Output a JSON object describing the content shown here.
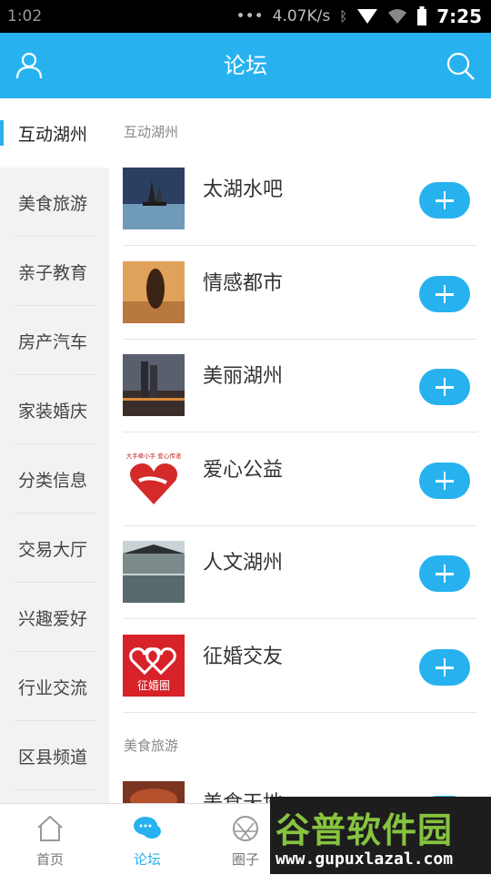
{
  "status_bar": {
    "left_time": "1:02",
    "speed": "4.07K/s",
    "clock": "7:25"
  },
  "header": {
    "title": "论坛",
    "user_icon": "user-icon",
    "search_icon": "search-icon"
  },
  "sidebar": {
    "items": [
      {
        "label": "互动湖州",
        "active": true
      },
      {
        "label": "美食旅游"
      },
      {
        "label": "亲子教育"
      },
      {
        "label": "房产汽车"
      },
      {
        "label": "家装婚庆"
      },
      {
        "label": "分类信息"
      },
      {
        "label": "交易大厅"
      },
      {
        "label": "兴趣爱好"
      },
      {
        "label": "行业交流"
      },
      {
        "label": "区县频道"
      }
    ]
  },
  "sections": [
    {
      "title": "互动湖州",
      "forums": [
        {
          "name": "太湖水吧"
        },
        {
          "name": "情感都市"
        },
        {
          "name": "美丽湖州"
        },
        {
          "name": "爱心公益"
        },
        {
          "name": "人文湖州"
        },
        {
          "name": "征婚交友"
        }
      ]
    },
    {
      "title": "美食旅游",
      "forums": [
        {
          "name": "美食天地"
        }
      ]
    }
  ],
  "thumb_text": {
    "love_caption": "大手牵小手 爱心传递",
    "marriage_caption": "征婚圈"
  },
  "bottom_nav": {
    "tabs": [
      {
        "label": "首页",
        "icon": "home-icon"
      },
      {
        "label": "论坛",
        "icon": "chat-icon",
        "active": true
      },
      {
        "label": "圈子",
        "icon": "circle-icon"
      }
    ]
  },
  "watermark": {
    "title": "谷普软件园",
    "url": "www.gupuxlazal.com"
  },
  "colors": {
    "accent": "#27b2ef",
    "sidebar_bg": "#f2f2f2",
    "watermark_green": "#86c33f"
  }
}
